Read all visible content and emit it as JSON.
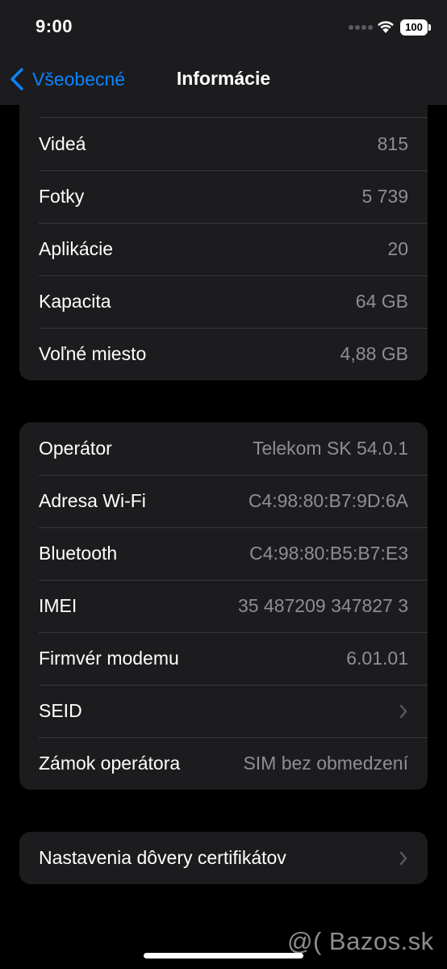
{
  "status_bar": {
    "time": "9:00",
    "battery": "100",
    "icons": [
      "signal-dots-icon",
      "wifi-icon",
      "battery-icon"
    ]
  },
  "nav": {
    "back_label": "Všeobecné",
    "title": "Informácie",
    "back_icon": "chevron-left-icon"
  },
  "group1": {
    "rows": [
      {
        "label": "Videá",
        "value": "815"
      },
      {
        "label": "Fotky",
        "value": "5 739"
      },
      {
        "label": "Aplikácie",
        "value": "20"
      },
      {
        "label": "Kapacita",
        "value": "64 GB"
      },
      {
        "label": "Voľné miesto",
        "value": "4,88 GB"
      }
    ]
  },
  "group2": {
    "rows": [
      {
        "label": "Operátor",
        "value": "Telekom SK 54.0.1"
      },
      {
        "label": "Adresa Wi-Fi",
        "value": "C4:98:80:B7:9D:6A"
      },
      {
        "label": "Bluetooth",
        "value": "C4:98:80:B5:B7:E3"
      },
      {
        "label": "IMEI",
        "value": "35 487209 347827 3"
      },
      {
        "label": "Firmvér modemu",
        "value": "6.01.01"
      },
      {
        "label": "SEID",
        "value": ""
      },
      {
        "label": "Zámok operátora",
        "value": "SIM bez obmedzení"
      }
    ]
  },
  "group3": {
    "rows": [
      {
        "label": "Nastavenia dôvery certifikátov"
      }
    ]
  },
  "watermark": "@( Bazos.sk",
  "colors": {
    "background": "#000000",
    "cell": "#1c1c1e",
    "separator": "#38383a",
    "accent": "#0a84ff",
    "secondary_text": "#8e8e93"
  }
}
